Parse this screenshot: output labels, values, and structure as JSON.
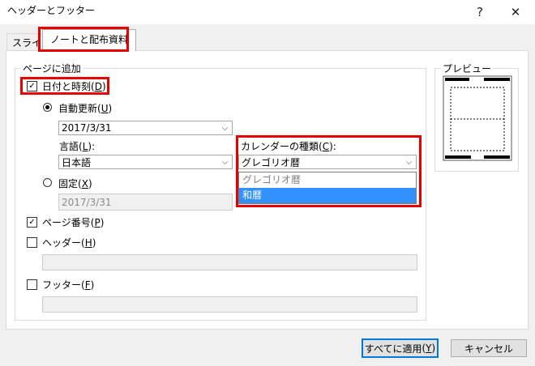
{
  "window": {
    "title": "ヘッダーとフッター",
    "help_glyph": "?",
    "close_glyph": "✕"
  },
  "tabs": [
    {
      "label": "スライド",
      "active": false
    },
    {
      "label": "ノートと配布資料",
      "active": true
    }
  ],
  "page_section": {
    "legend": "ページに追加",
    "date_time": {
      "label": "日付と時刻",
      "accel": "D",
      "checked": true
    },
    "auto_update": {
      "label": "自動更新",
      "accel": "U",
      "selected": true,
      "value": "2017/3/31"
    },
    "language": {
      "label": "言語",
      "accel": "L",
      "value": "日本語"
    },
    "calendar": {
      "label": "カレンダーの種類",
      "accel": "C",
      "value": "グレゴリオ暦",
      "options": [
        "グレゴリオ暦",
        "和暦"
      ],
      "highlighted": "和暦"
    },
    "fixed": {
      "label": "固定",
      "accel": "X",
      "selected": false,
      "value": "2017/3/31"
    },
    "page_number": {
      "label": "ページ番号",
      "accel": "P",
      "checked": true
    },
    "header": {
      "label": "ヘッダー",
      "accel": "H",
      "checked": false,
      "value": ""
    },
    "footer": {
      "label": "フッター",
      "accel": "F",
      "checked": false,
      "value": ""
    }
  },
  "preview": {
    "legend": "プレビュー"
  },
  "buttons": {
    "apply_all": {
      "label": "すべてに適用",
      "accel": "Y"
    },
    "cancel": {
      "label": "キャンセル"
    }
  },
  "colors": {
    "highlight_box": "#e60000",
    "selection": "#3390ff",
    "default_button_border": "#0078d7"
  }
}
